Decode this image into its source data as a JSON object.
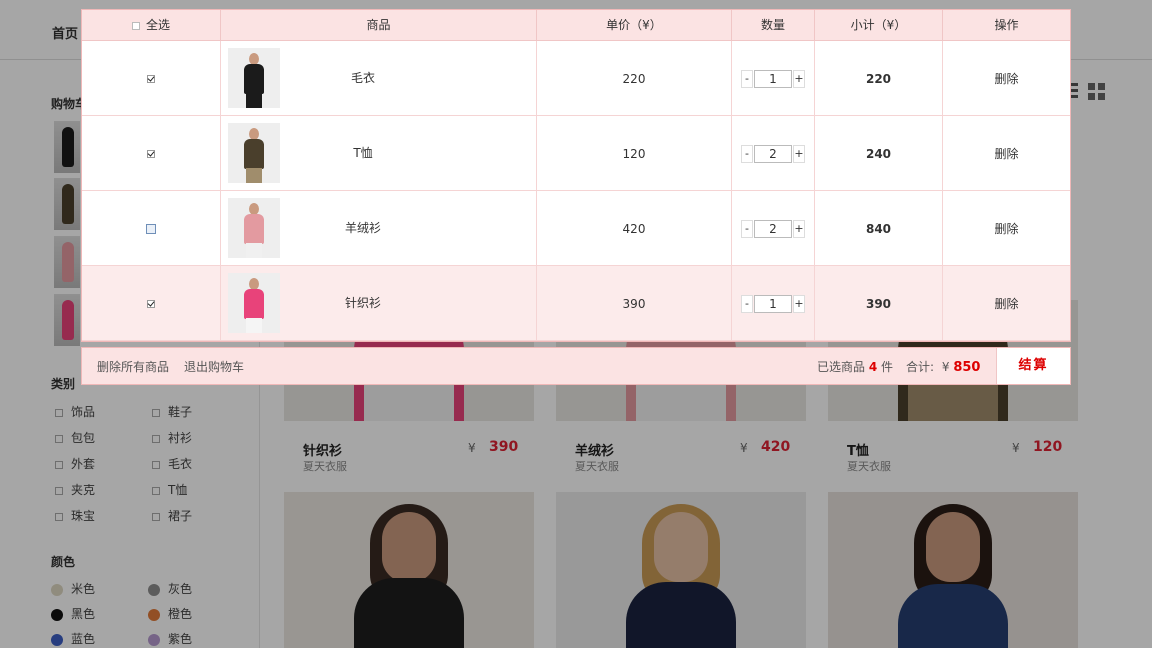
{
  "nav": {
    "home": "首页"
  },
  "sidebar": {
    "cart_title": "购物车",
    "category_title": "类别",
    "categories": [
      "饰品",
      "鞋子",
      "包包",
      "衬衫",
      "外套",
      "毛衣",
      "夹克",
      "T恤",
      "珠宝",
      "裙子"
    ],
    "color_title": "颜色",
    "colors": [
      {
        "label": "米色",
        "hex": "#ded7c2"
      },
      {
        "label": "灰色",
        "hex": "#8e8e8e"
      },
      {
        "label": "黑色",
        "hex": "#111111"
      },
      {
        "label": "橙色",
        "hex": "#e07a3a"
      },
      {
        "label": "蓝色",
        "hex": "#3c5fc4"
      },
      {
        "label": "紫色",
        "hex": "#b69ad0"
      }
    ]
  },
  "products": [
    {
      "name": "针织衫",
      "sub": "夏天衣服",
      "yen": "¥",
      "price": "390"
    },
    {
      "name": "羊绒衫",
      "sub": "夏天衣服",
      "yen": "¥",
      "price": "420"
    },
    {
      "name": "T恤",
      "sub": "夏天衣服",
      "yen": "¥",
      "price": "120"
    }
  ],
  "cart": {
    "headers": {
      "select_all": "全选",
      "product": "商品",
      "unit_price": "单价（¥）",
      "quantity": "数量",
      "subtotal": "小计（¥）",
      "action": "操作"
    },
    "rows": [
      {
        "checked": true,
        "name": "毛衣",
        "price": "220",
        "qty": "1",
        "subtotal": "220",
        "action": "删除",
        "color": "#1b1b1b",
        "legs": "#1b1b1b"
      },
      {
        "checked": true,
        "name": "T恤",
        "price": "120",
        "qty": "2",
        "subtotal": "240",
        "action": "删除",
        "color": "#4a3f2c",
        "legs": "#a08d6c"
      },
      {
        "checked": false,
        "name": "羊绒衫",
        "price": "420",
        "qty": "2",
        "subtotal": "840",
        "action": "删除",
        "color": "#e39aa0",
        "legs": "#f0f0f0"
      },
      {
        "checked": true,
        "name": "针织衫",
        "price": "390",
        "qty": "1",
        "subtotal": "390",
        "action": "删除",
        "color": "#e8437a",
        "legs": "#f5f5f5"
      }
    ],
    "minus": "-",
    "plus": "+",
    "footer": {
      "delete_all": "删除所有商品",
      "exit_cart": "退出购物车",
      "selected_label": "已选商品",
      "selected_count": "4",
      "selected_unit": "件",
      "total_label": "合计:",
      "yen": "¥",
      "total": "850",
      "checkout": "结算"
    }
  }
}
